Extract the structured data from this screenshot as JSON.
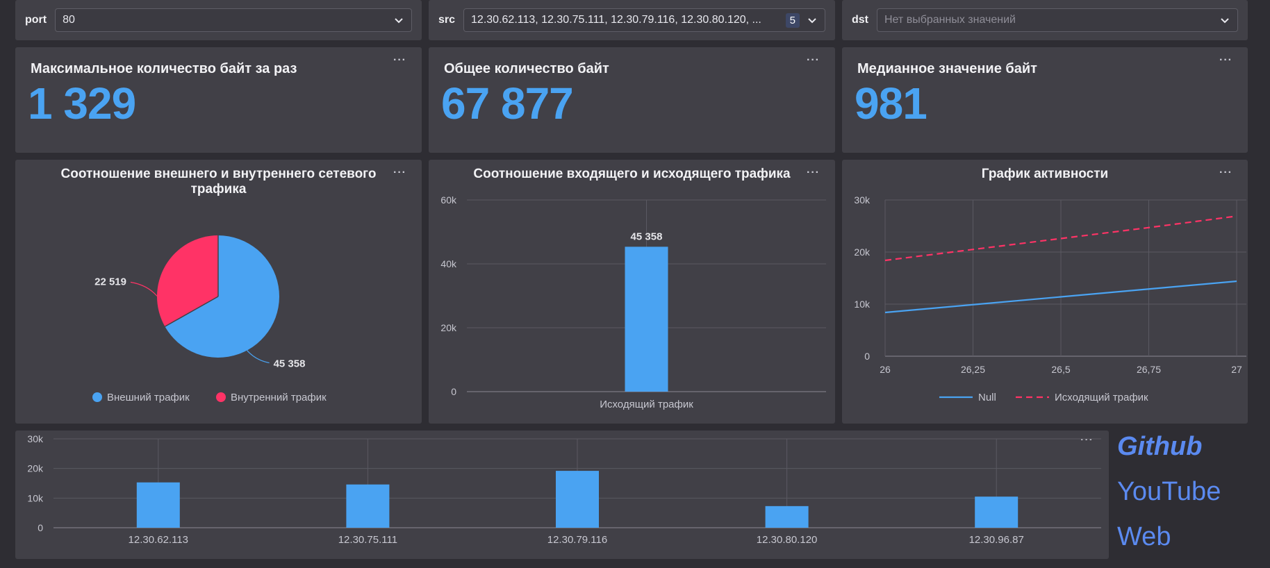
{
  "filters": {
    "port": {
      "label": "port",
      "value": "80"
    },
    "src": {
      "label": "src",
      "value": "12.30.62.113, 12.30.75.111, 12.30.79.116, 12.30.80.120, ...",
      "count": "5"
    },
    "dst": {
      "label": "dst",
      "placeholder": "Нет выбранных значений"
    }
  },
  "kpis": [
    {
      "title": "Максимальное количество байт за раз",
      "value": "1 329"
    },
    {
      "title": "Общее количество байт",
      "value": "67 877"
    },
    {
      "title": "Медианное значение байт",
      "value": "981"
    }
  ],
  "menu_dots": "···",
  "colors": {
    "accent": "#4aa3f2",
    "red": "#ff3366",
    "panel": "#414047",
    "bg": "#2e2d33"
  },
  "chart_data": [
    {
      "type": "pie",
      "title_line1": "Соотношение внешнего и внутреннего сетевого",
      "title_line2": "трафика",
      "slices": [
        {
          "name": "Внешний трафик",
          "value": 45358,
          "label": "45 358",
          "color": "#4aa3f2"
        },
        {
          "name": "Внутренний трафик",
          "value": 22519,
          "label": "22 519",
          "color": "#ff3366"
        }
      ],
      "legend": "bottom"
    },
    {
      "type": "bar",
      "title": "Соотношение входящего и исходящего трафика",
      "categories": [
        "Исходящий трафик"
      ],
      "values": [
        45358
      ],
      "value_labels": [
        "45 358"
      ],
      "yticks": [
        "0",
        "20k",
        "40k",
        "60k"
      ],
      "ylim": [
        0,
        60000
      ],
      "grid": true
    },
    {
      "type": "line",
      "title": "График активности",
      "x": [
        26,
        26.25,
        26.5,
        26.75,
        27
      ],
      "xticks": [
        "26",
        "26,25",
        "26,5",
        "26,75",
        "27"
      ],
      "yticks": [
        "0",
        "10k",
        "20k",
        "30k"
      ],
      "ylim": [
        0,
        30000
      ],
      "series": [
        {
          "name": "Null",
          "values": [
            8400,
            9900,
            11400,
            12900,
            14400
          ],
          "color": "#4aa3f2",
          "dash": false
        },
        {
          "name": "Исходящий трафик",
          "values": [
            18400,
            20500,
            22600,
            24700,
            26900
          ],
          "color": "#ff3366",
          "dash": true
        }
      ],
      "legend": "bottom",
      "grid": true
    },
    {
      "type": "bar",
      "categories": [
        "12.30.62.113",
        "12.30.75.111",
        "12.30.79.116",
        "12.30.80.120",
        "12.30.96.87"
      ],
      "values": [
        15300,
        14600,
        19200,
        7300,
        10500
      ],
      "yticks": [
        "0",
        "10k",
        "20k",
        "30k"
      ],
      "ylim": [
        0,
        30000
      ],
      "grid": true
    }
  ],
  "links": {
    "github": "Github",
    "youtube": "YouTube",
    "web": "Web"
  }
}
